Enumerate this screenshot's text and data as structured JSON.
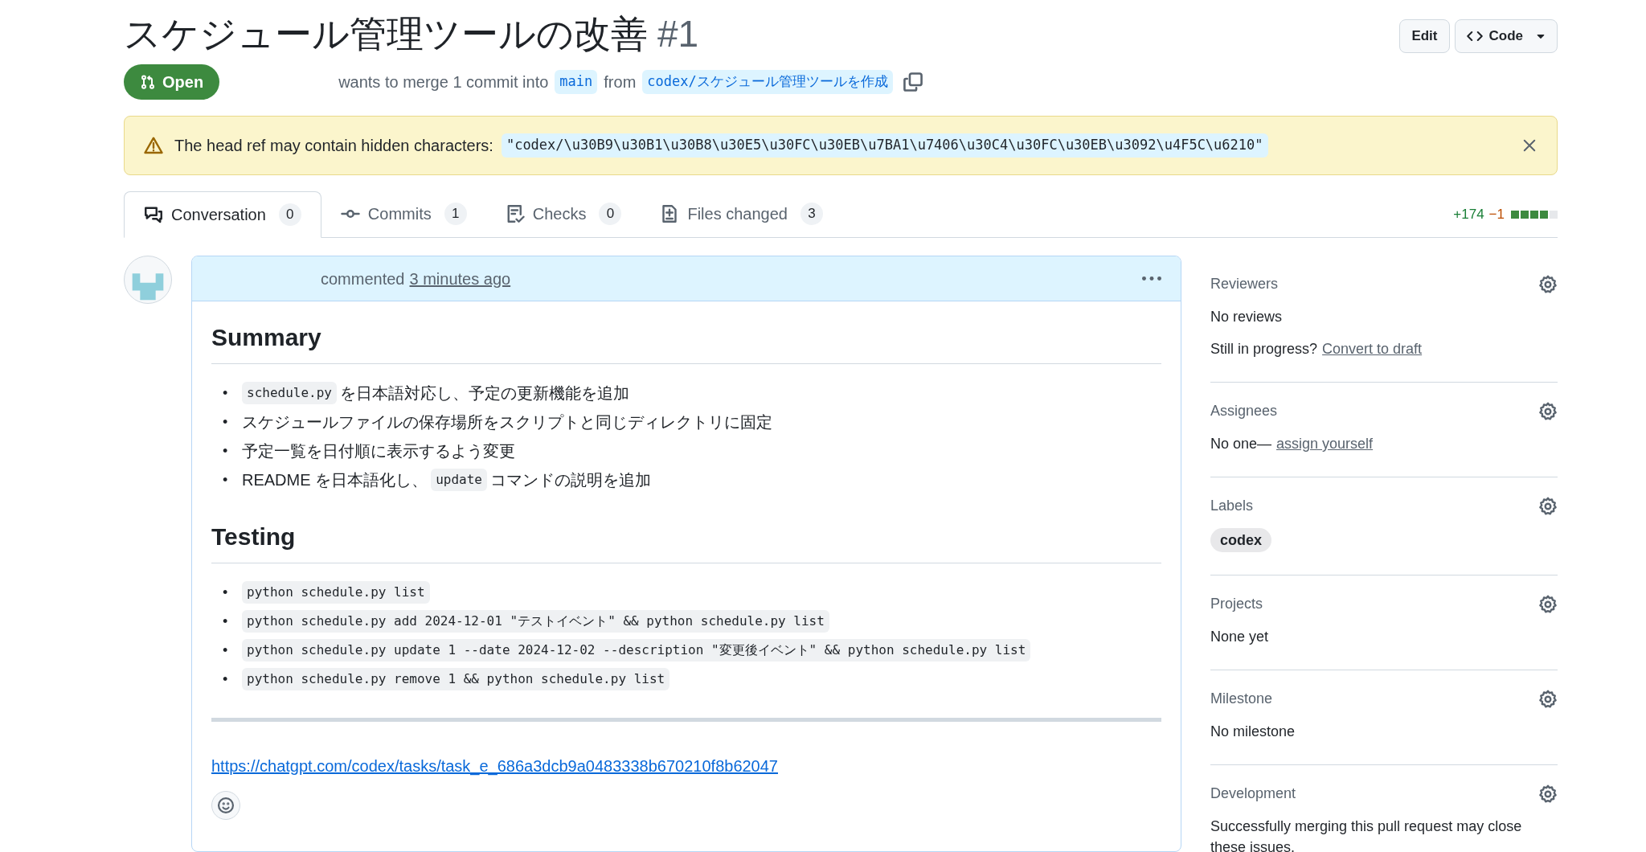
{
  "header": {
    "title": "スケジュール管理ツールの改善",
    "number": "#1",
    "actions": [
      "Edit",
      "Code"
    ]
  },
  "status": {
    "label": "Open",
    "text_before": "wants to merge 1 commit into",
    "base": "main",
    "text_from": "from",
    "head": "codex/スケジュール管理ツールを作成"
  },
  "warning": {
    "text": "The head ref may contain hidden characters:",
    "ref": "\"codex/\\u30B9\\u30B1\\u30B8\\u30E5\\u30FC\\u30EB\\u7BA1\\u7406\\u30C4\\u30FC\\u30EB\\u3092\\u4F5C\\u6210\""
  },
  "tabs": [
    {
      "kind": "conversation",
      "label": "Conversation",
      "count": "0",
      "selected": true
    },
    {
      "kind": "commits",
      "label": "Commits",
      "count": "1",
      "selected": false
    },
    {
      "kind": "checks",
      "label": "Checks",
      "count": "0",
      "selected": false
    },
    {
      "kind": "files",
      "label": "Files changed",
      "count": "3",
      "selected": false
    }
  ],
  "diffstat": {
    "added": "+174",
    "removed": "−1",
    "blocks": [
      {
        "filled": true
      },
      {
        "filled": true
      },
      {
        "filled": true
      },
      {
        "filled": true
      },
      {
        "filled": false
      }
    ]
  },
  "comment": {
    "action": "commented",
    "time": "3 minutes ago",
    "sections": [
      {
        "heading": "Summary",
        "items": [
          {
            "marker": "•",
            "parts": [
              {
                "kind": "code",
                "text": "schedule.py"
              },
              {
                "kind": "text",
                "text": "を日本語対応し、予定の更新機能を追加"
              }
            ]
          },
          {
            "marker": "•",
            "parts": [
              {
                "kind": "text",
                "text": "スケジュールファイルの保存場所をスクリプトと同じディレクトリに固定"
              }
            ]
          },
          {
            "marker": "•",
            "parts": [
              {
                "kind": "text",
                "text": "予定一覧を日付順に表示するよう変更"
              }
            ]
          },
          {
            "marker": "•",
            "parts": [
              {
                "kind": "text",
                "text": "README を日本語化し、"
              },
              {
                "kind": "code",
                "text": "update"
              },
              {
                "kind": "text",
                "text": "コマンドの説明を追加"
              }
            ]
          }
        ]
      },
      {
        "heading": "Testing",
        "items": [
          {
            "marker": "•",
            "parts": [
              {
                "kind": "code",
                "text": "python schedule.py list"
              }
            ]
          },
          {
            "marker": "•",
            "parts": [
              {
                "kind": "code",
                "text": "python schedule.py add 2024-12-01 \"テストイベント\" && python schedule.py list"
              }
            ]
          },
          {
            "marker": "•",
            "parts": [
              {
                "kind": "code",
                "text": "python schedule.py update 1 --date 2024-12-02 --description \"変更後イベント\" && python schedule.py list"
              }
            ]
          },
          {
            "marker": "•",
            "parts": [
              {
                "kind": "code",
                "text": "python schedule.py remove 1 && python schedule.py list"
              }
            ]
          }
        ]
      }
    ],
    "link": "https://chatgpt.com/codex/tasks/task_e_686a3dcb9a0483338b670210f8b62047"
  },
  "sidebar": [
    {
      "title": "Reviewers",
      "lines": [
        [
          {
            "kind": "text",
            "text": "No reviews"
          }
        ],
        [
          {
            "kind": "text",
            "text": "Still in progress?"
          },
          {
            "kind": "link",
            "text": "Convert to draft"
          }
        ]
      ]
    },
    {
      "title": "Assignees",
      "lines": [
        [
          {
            "kind": "text",
            "text": "No one—"
          },
          {
            "kind": "link",
            "text": "assign yourself"
          }
        ]
      ]
    },
    {
      "title": "Labels",
      "lines": [
        [
          {
            "kind": "label",
            "text": "codex"
          }
        ]
      ]
    },
    {
      "title": "Projects",
      "lines": [
        [
          {
            "kind": "text",
            "text": "None yet"
          }
        ]
      ]
    },
    {
      "title": "Milestone",
      "lines": [
        [
          {
            "kind": "text",
            "text": "No milestone"
          }
        ]
      ]
    },
    {
      "title": "Development",
      "lines": [
        [
          {
            "kind": "text",
            "text": "Successfully merging this pull request may close these issues."
          }
        ]
      ]
    }
  ]
}
